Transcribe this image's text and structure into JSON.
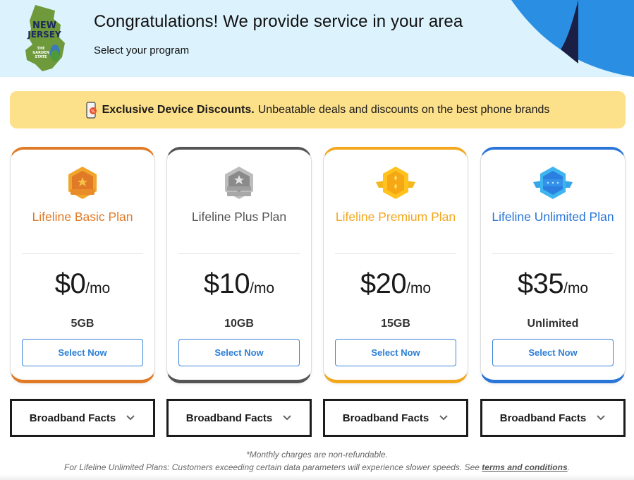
{
  "header": {
    "logo": {
      "line1": "NEW",
      "line2": "JERSEY",
      "tag1": "THE",
      "tag2": "GARDEN",
      "tag3": "STATE"
    },
    "title": "Congratulations! We provide service in your area",
    "subtitle": "Select your program"
  },
  "banner": {
    "icon": "phone-discount-icon",
    "bold": "Exclusive Device Discounts.",
    "text": "Unbeatable deals and discounts on the best phone brands"
  },
  "plans": [
    {
      "name": "Lifeline Basic Plan",
      "price": "$0",
      "per": "/mo",
      "data": "5GB",
      "button": "Select Now",
      "color": "#e07a26",
      "badge": "bronze-badge-icon"
    },
    {
      "name": "Lifeline Plus Plan",
      "price": "$10",
      "per": "/mo",
      "data": "10GB",
      "button": "Select Now",
      "color": "#555555",
      "badge": "silver-badge-icon"
    },
    {
      "name": "Lifeline Premium Plan",
      "price": "$20",
      "per": "/mo",
      "data": "15GB",
      "button": "Select Now",
      "color": "#f3a71c",
      "badge": "gold-badge-icon"
    },
    {
      "name": "Lifeline Unlimited Plan",
      "price": "$35",
      "per": "/mo",
      "data": "Unlimited",
      "button": "Select Now",
      "color": "#2a76d8",
      "badge": "diamond-badge-icon"
    }
  ],
  "broadband": [
    {
      "label": "Broadband Facts"
    },
    {
      "label": "Broadband Facts"
    },
    {
      "label": "Broadband Facts"
    },
    {
      "label": "Broadband Facts"
    }
  ],
  "footer": {
    "note1": "*Monthly charges are non-refundable.",
    "note2": "For Lifeline Unlimited Plans: Customers exceeding certain data parameters will experience slower speeds. See ",
    "link": "terms and conditions",
    "end": "."
  }
}
